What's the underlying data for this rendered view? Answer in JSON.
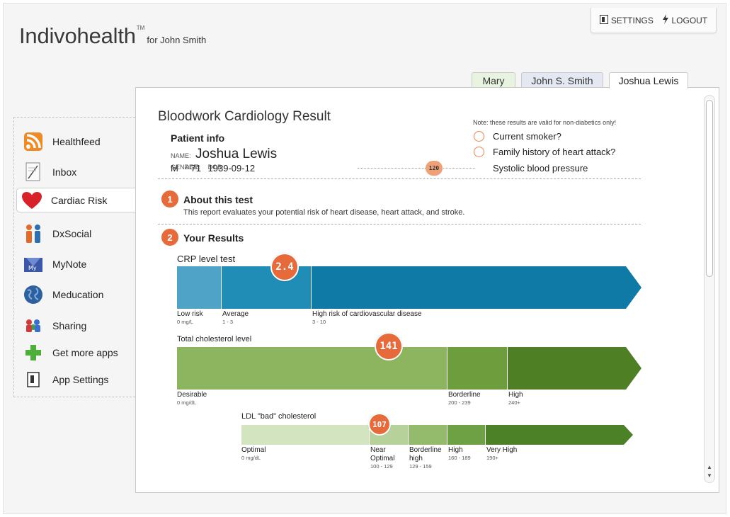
{
  "header": {
    "brand": "Indivohealth",
    "trademark": "TM",
    "for_user": "for John Smith",
    "settings_label": "SETTINGS",
    "logout_label": "LOGOUT"
  },
  "tabs": [
    {
      "label": "Mary"
    },
    {
      "label": "John S. Smith"
    },
    {
      "label": "Joshua Lewis"
    }
  ],
  "sidebar": {
    "items": [
      {
        "label": "Healthfeed",
        "icon": "rss-icon"
      },
      {
        "label": "Inbox",
        "icon": "inbox-icon"
      },
      {
        "label": "Cardiac Risk",
        "icon": "heart-icon"
      },
      {
        "label": "DxSocial",
        "icon": "people-icon"
      },
      {
        "label": "MyNote",
        "icon": "note-icon"
      },
      {
        "label": "Meducation",
        "icon": "globe-icon"
      },
      {
        "label": "Sharing",
        "icon": "sharing-icon"
      },
      {
        "label": "Get more apps",
        "icon": "plus-icon"
      },
      {
        "label": "App Settings",
        "icon": "settings-icon"
      }
    ]
  },
  "report": {
    "title": "Bloodwork Cardiology Result",
    "patient_info_heading": "Patient info",
    "name_label": "NAME:",
    "name": "Joshua Lewis",
    "gender_label": "GENDER:",
    "gender": "M",
    "age_label": "AGE:",
    "age": "71",
    "dob_label": "DOB:",
    "dob": "1939-09-12",
    "note": "Note: these results are valid for non-diabetics only!",
    "options": [
      {
        "label": "Current smoker?"
      },
      {
        "label": "Family history of heart attack?"
      }
    ],
    "systolic_value": "120",
    "systolic_label": "Systolic blood pressure"
  },
  "sections": {
    "about": {
      "number": "1",
      "title": "About this test",
      "text": "This report evaluates your potential risk of heart disease, heart attack, and stroke."
    },
    "results": {
      "number": "2",
      "title": "Your Results"
    }
  },
  "results": {
    "crp": {
      "title": "CRP level test",
      "value": "2.4",
      "ranges": [
        {
          "label": "Low risk",
          "range": "0 mg/L"
        },
        {
          "label": "Average",
          "range": "1 - 3"
        },
        {
          "label": "High risk of cardiovascular disease",
          "range": "3 - 10"
        }
      ],
      "colors": [
        "#4fa3c7",
        "#1f8db5",
        "#0f7aa6"
      ]
    },
    "cholesterol": {
      "title": "Total cholesterol level",
      "value": "141",
      "ranges": [
        {
          "label": "Desirable",
          "range": "0 mg/dL"
        },
        {
          "label": "Borderline",
          "range": "200 - 239"
        },
        {
          "label": "High",
          "range": "240+"
        }
      ],
      "colors": [
        "#8db55f",
        "#6e9d3e",
        "#4f7f25"
      ]
    },
    "ldl": {
      "title": "LDL \"bad\" cholesterol",
      "value": "107",
      "ranges": [
        {
          "label": "Optimal",
          "range": "0 mg/dL"
        },
        {
          "label": "Near Optimal",
          "range": "100 - 129"
        },
        {
          "label": "Borderline high",
          "range": "129 - 159"
        },
        {
          "label": "High",
          "range": "160 - 189"
        },
        {
          "label": "Very High",
          "range": "190+"
        }
      ],
      "colors": [
        "#d3e4c0",
        "#b6d29a",
        "#93bb6b",
        "#6ea044",
        "#4d8127"
      ]
    }
  }
}
